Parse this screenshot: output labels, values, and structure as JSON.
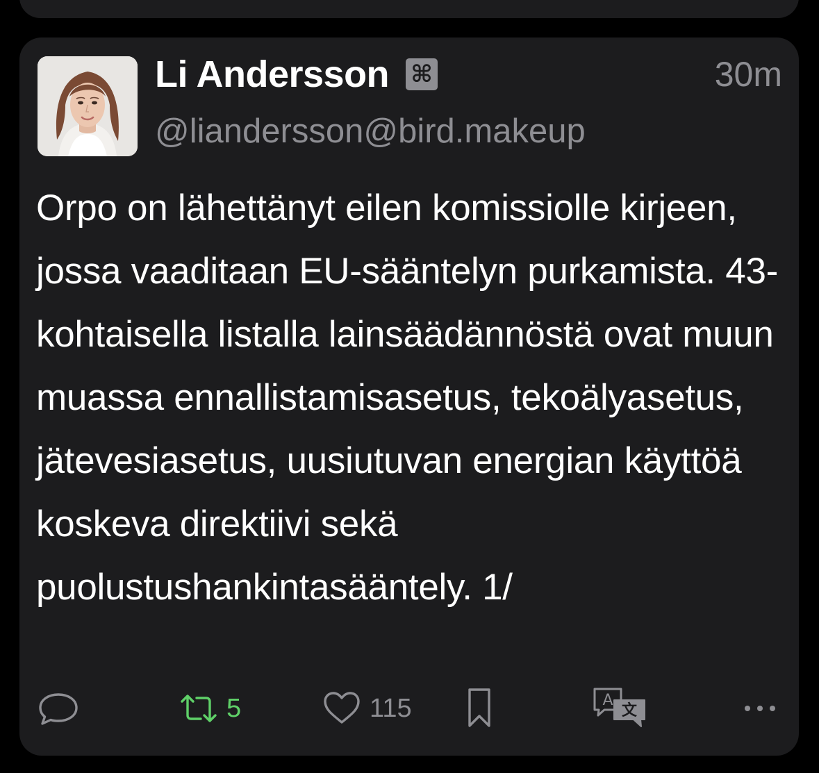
{
  "post": {
    "author_name": "Li Andersson",
    "bot_badge": "⌘",
    "handle": "@liandersson@bird.makeup",
    "timestamp": "30m",
    "text": "Orpo on lähettänyt eilen komissiolle kirjeen, jossa vaaditaan EU-sääntelyn purkamista. 43-kohtaisella listalla lainsäädännöstä ovat muun muassa ennallistamisasetus, tekoälyasetus, jätevesiasetus, uusiutuvan energian käyttöä koskeva direktiivi sekä puolustushankintasääntely. 1/"
  },
  "actions": {
    "reply_icon": "speech-bubble-icon",
    "boost_icon": "repost-icon",
    "boost_count": "5",
    "like_icon": "heart-icon",
    "like_count": "115",
    "bookmark_icon": "bookmark-icon",
    "translate_icon": "translate-icon",
    "more_icon": "more-dots-icon"
  },
  "colors": {
    "background": "#000000",
    "card": "#1c1c1e",
    "primary_text": "#ffffff",
    "secondary_text": "#8e8e93",
    "boost_active": "#5fd068"
  }
}
